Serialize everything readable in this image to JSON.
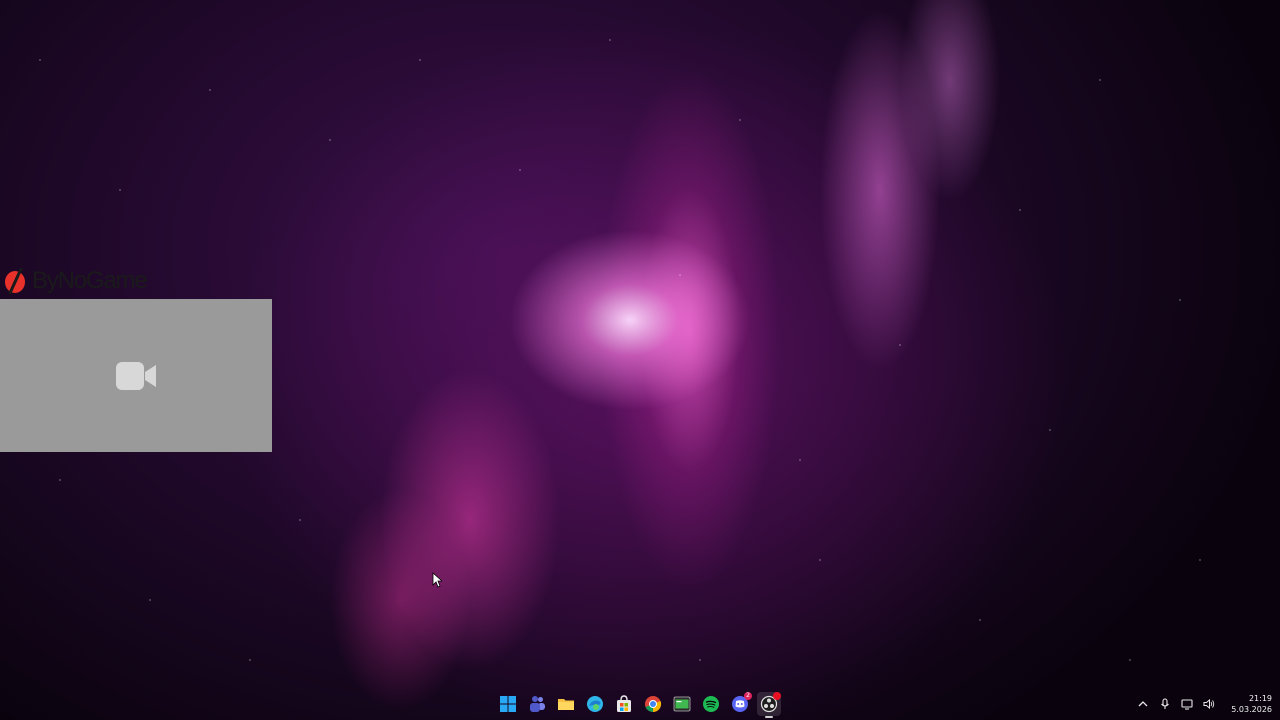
{
  "overlay": {
    "logo_text": "ByNoGame",
    "brand_color": "#e8312a",
    "webcam_icon": "video-camera-icon"
  },
  "taskbar": {
    "apps": [
      {
        "name": "start-button",
        "icon": "windows-icon",
        "color": "#29a8f5"
      },
      {
        "name": "teams-button",
        "icon": "teams-icon",
        "color": "#7b83eb"
      },
      {
        "name": "file-explorer-button",
        "icon": "folder-icon",
        "color": "#f5c242"
      },
      {
        "name": "edge-button",
        "icon": "edge-icon",
        "color": "#2fb5e8"
      },
      {
        "name": "store-button",
        "icon": "store-icon",
        "color": "#e8e8e8"
      },
      {
        "name": "chrome-button",
        "icon": "chrome-icon",
        "color": "#4285f4"
      },
      {
        "name": "terminal-button",
        "icon": "terminal-icon",
        "color": "#3fb950"
      },
      {
        "name": "spotify-button",
        "icon": "spotify-icon",
        "color": "#1db954"
      },
      {
        "name": "discord-button",
        "icon": "discord-icon",
        "color": "#5865f2",
        "badge": "2"
      },
      {
        "name": "obs-button",
        "icon": "obs-icon",
        "color": "#e0e0e0"
      }
    ],
    "tray": {
      "chevron_icon": "chevron-up-icon",
      "mic_icon": "microphone-icon",
      "display_icon": "display-icon",
      "volume_icon": "volume-icon"
    },
    "clock": {
      "time": "21:19",
      "date": "5.03.2026"
    }
  }
}
